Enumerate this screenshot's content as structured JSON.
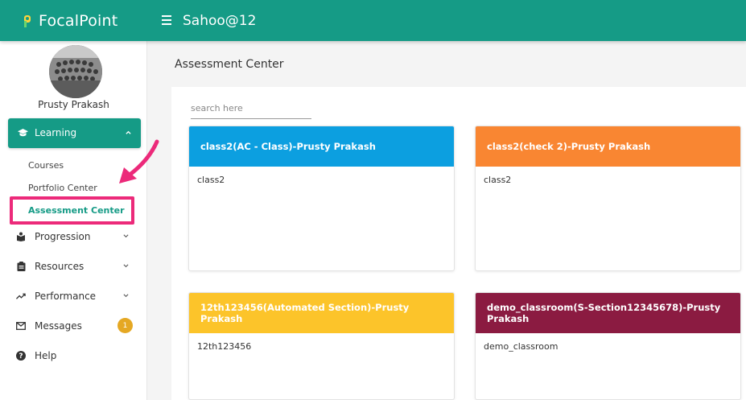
{
  "header": {
    "brand": "FocalPoint",
    "user": "Sahoo@12",
    "color": "#159b86"
  },
  "sidebar": {
    "profile_name": "Prusty Prakash",
    "learning": {
      "label": "Learning",
      "expanded": true,
      "subitems": [
        {
          "label": "Courses"
        },
        {
          "label": "Portfolio Center"
        },
        {
          "label": "Assessment Center",
          "active": true
        }
      ]
    },
    "items": [
      {
        "label": "Progression",
        "icon": "progression-icon"
      },
      {
        "label": "Resources",
        "icon": "clipboard-icon"
      },
      {
        "label": "Performance",
        "icon": "trend-icon"
      },
      {
        "label": "Messages",
        "icon": "mail-icon",
        "badge": "1"
      },
      {
        "label": "Help",
        "icon": "help-icon"
      }
    ]
  },
  "main": {
    "title": "Assessment Center",
    "search_placeholder": "search here",
    "cards": [
      {
        "title": "class2(AC - Class)-Prusty Prakash",
        "body": "class2",
        "color": "#0c9fe0"
      },
      {
        "title": "class2(check 2)-Prusty Prakash",
        "body": "class2",
        "color": "#f98632"
      },
      {
        "title": "12th123456(Automated Section)-Prusty Prakash",
        "body": "12th123456",
        "color": "#fcc42a"
      },
      {
        "title": "demo_classroom(S-Section12345678)-Prusty Prakash",
        "body": "demo_classroom",
        "color": "#8b1b41"
      }
    ]
  },
  "annotation": {
    "color": "#ec2a7a"
  }
}
